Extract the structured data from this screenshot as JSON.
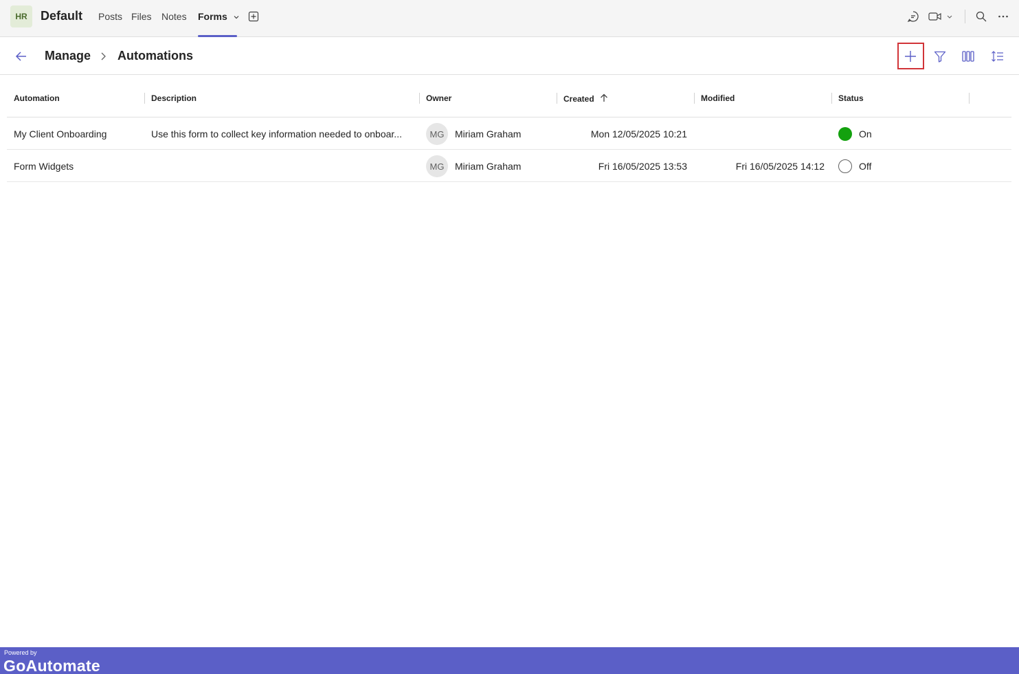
{
  "team": {
    "avatar_initials": "HR",
    "name": "Default",
    "tabs": [
      {
        "label": "Posts"
      },
      {
        "label": "Files"
      },
      {
        "label": "Notes"
      },
      {
        "label": "Forms",
        "active": true
      }
    ]
  },
  "topbar_icons": [
    "add-tab-icon",
    "chat-icon",
    "video-call-icon",
    "search-icon",
    "more-options-icon"
  ],
  "breadcrumb": {
    "parent": "Manage",
    "current": "Automations"
  },
  "toolbar_icons": [
    "add-icon",
    "filter-icon",
    "columns-icon",
    "sort-icon"
  ],
  "table": {
    "columns": [
      "Automation",
      "Description",
      "Owner",
      "Created",
      "Modified",
      "Status"
    ],
    "sorted_column": "Created",
    "sort_direction": "ascending",
    "rows": [
      {
        "automation": "My Client Onboarding",
        "description": "Use this form to collect key information needed to onboar...",
        "owner_initials": "MG",
        "owner": "Miriam Graham",
        "created": "Mon 12/05/2025 10:21",
        "modified": "",
        "status": "On"
      },
      {
        "automation": "Form Widgets",
        "description": "",
        "owner_initials": "MG",
        "owner": "Miriam Graham",
        "created": "Fri 16/05/2025 13:53",
        "modified": "Fri 16/05/2025 14:12",
        "status": "Off"
      }
    ]
  },
  "footer": {
    "powered_by": "Powered by",
    "brand": "GoAutomate"
  },
  "colors": {
    "accent": "#5b5fc7",
    "status_on": "#13a10e",
    "highlight_box": "#d13438"
  }
}
